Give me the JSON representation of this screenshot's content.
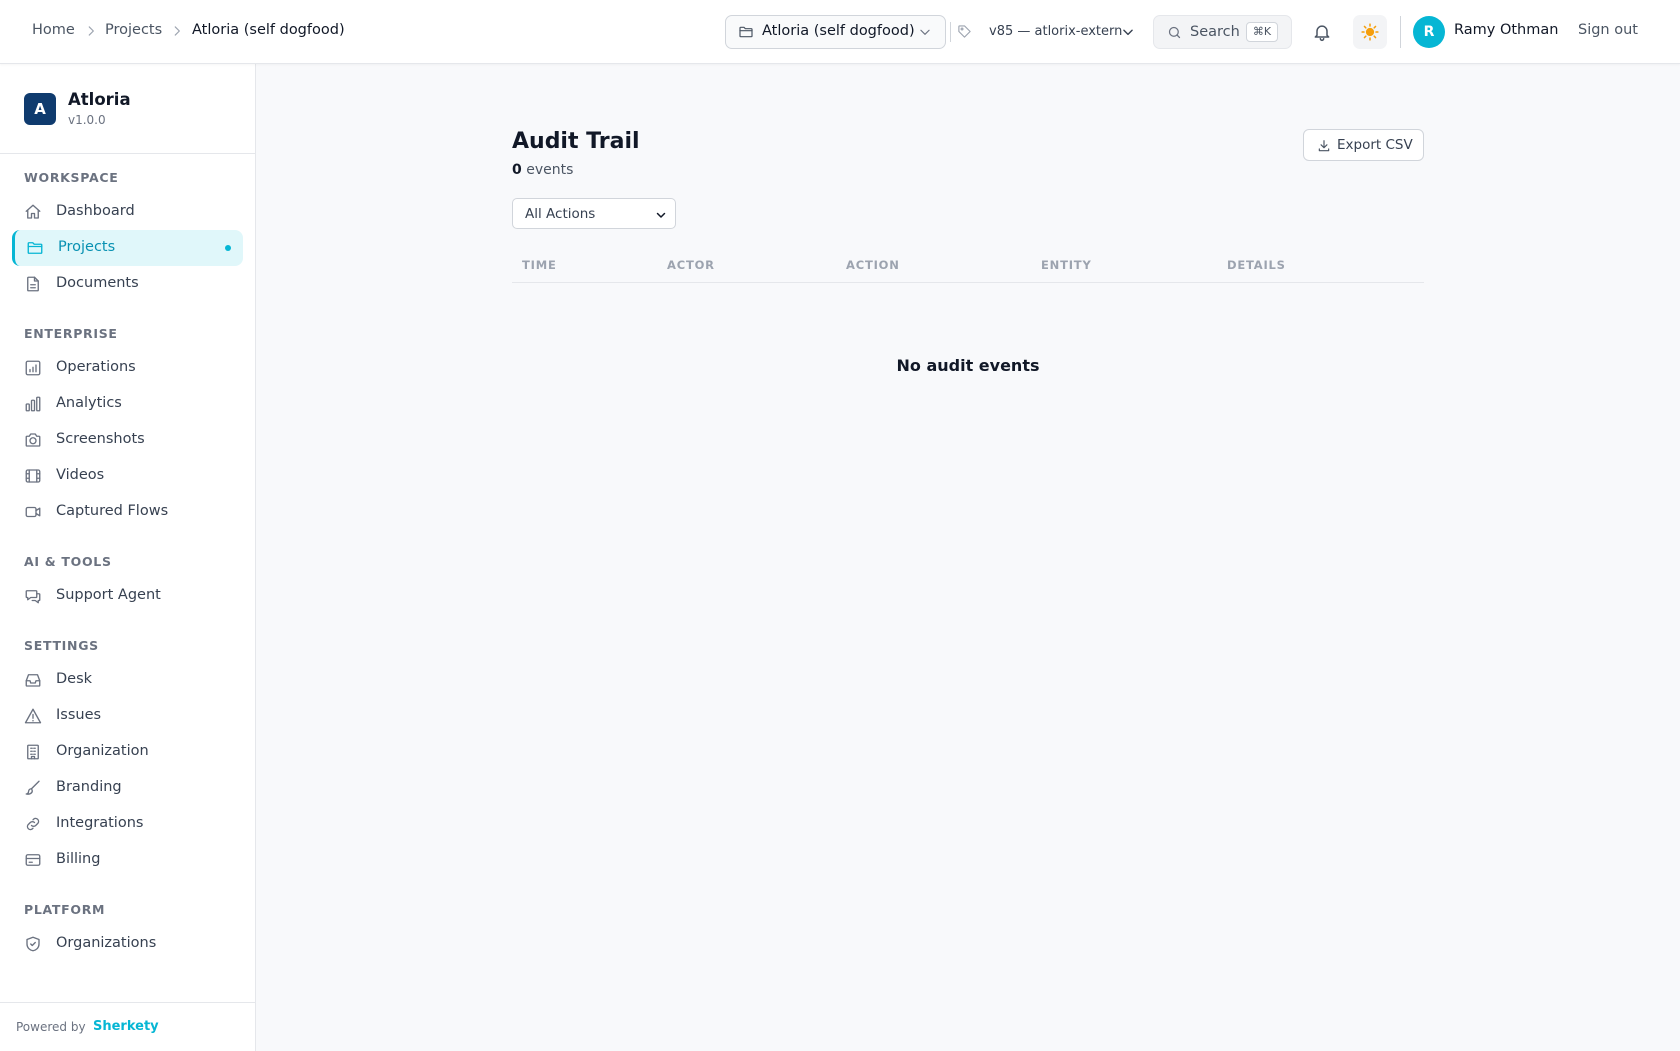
{
  "breadcrumb": {
    "items": [
      "Home",
      "Projects",
      "Atloria (self dogfood)"
    ]
  },
  "topbar": {
    "project_select": "Atloria (self dogfood)",
    "version_select": "v85 — atlorix-extern",
    "search_label": "Search",
    "search_shortcut": "⌘K",
    "user_initial": "R",
    "user_name": "Ramy Othman",
    "sign_out": "Sign out"
  },
  "brand": {
    "logo_letter": "A",
    "name": "Atloria",
    "version": "v1.0.0"
  },
  "sidebar": {
    "sections": [
      {
        "title": "WORKSPACE",
        "items": [
          {
            "label": "Dashboard",
            "icon": "home-icon"
          },
          {
            "label": "Projects",
            "icon": "folder-icon",
            "active": true
          },
          {
            "label": "Documents",
            "icon": "document-icon"
          }
        ]
      },
      {
        "title": "ENTERPRISE",
        "items": [
          {
            "label": "Operations",
            "icon": "operations-chart-icon"
          },
          {
            "label": "Analytics",
            "icon": "bar-chart-icon"
          },
          {
            "label": "Screenshots",
            "icon": "camera-icon"
          },
          {
            "label": "Videos",
            "icon": "film-icon"
          },
          {
            "label": "Captured Flows",
            "icon": "video-camera-icon"
          }
        ]
      },
      {
        "title": "AI & TOOLS",
        "items": [
          {
            "label": "Support Agent",
            "icon": "chat-icon"
          }
        ]
      },
      {
        "title": "SETTINGS",
        "items": [
          {
            "label": "Desk",
            "icon": "inbox-icon"
          },
          {
            "label": "Issues",
            "icon": "warning-icon"
          },
          {
            "label": "Organization",
            "icon": "building-icon"
          },
          {
            "label": "Branding",
            "icon": "brush-icon"
          },
          {
            "label": "Integrations",
            "icon": "link-icon"
          },
          {
            "label": "Billing",
            "icon": "credit-card-icon"
          }
        ]
      },
      {
        "title": "PLATFORM",
        "items": [
          {
            "label": "Organizations",
            "icon": "shield-check-icon"
          }
        ]
      }
    ],
    "footer": {
      "powered_by": "Powered by",
      "powered_brand": "Sherkety"
    }
  },
  "main": {
    "title": "Audit Trail",
    "event_count": "0",
    "event_count_suffix": "events",
    "export_button": "Export CSV",
    "action_filter": {
      "selected": "All Actions"
    },
    "table": {
      "columns": [
        "TIME",
        "ACTOR",
        "ACTION",
        "ENTITY",
        "DETAILS"
      ]
    },
    "empty_message": "No audit events"
  },
  "colors": {
    "accent": "#06b6d4",
    "brand_logo": "#0f3b6e",
    "active_nav_bg": "#e0f7fa",
    "sun_icon": "#f59e0b"
  }
}
